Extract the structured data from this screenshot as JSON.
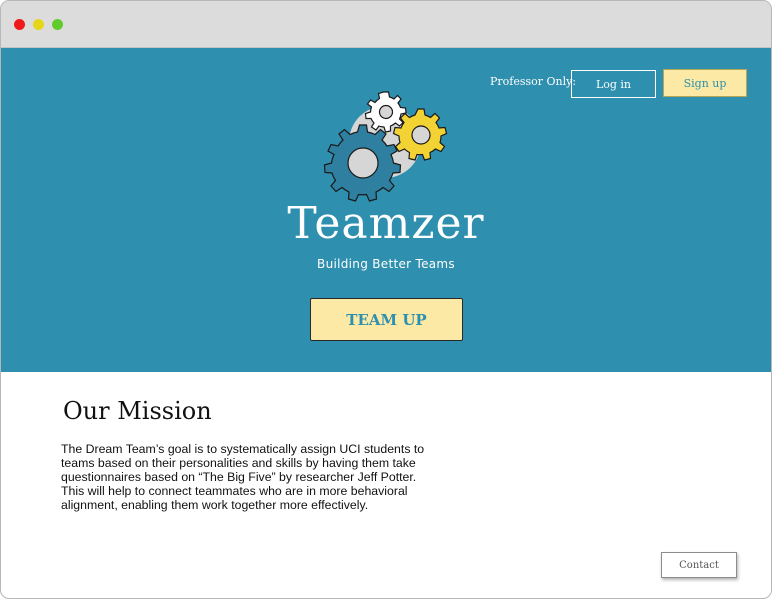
{
  "window": {
    "controls": [
      "close",
      "minimize",
      "maximize"
    ]
  },
  "header": {
    "professor_label": "Professor Only:",
    "login_label": "Log in",
    "signup_label": "Sign up"
  },
  "hero": {
    "logo_icon": "gears-icon",
    "brand_name": "Teamzer",
    "tagline": "Building Better Teams",
    "cta_label": "TEAM UP"
  },
  "mission": {
    "title": "Our Mission",
    "body": "The Dream Team’s goal is to systematically assign UCI students to teams based on their personalities and skills by having them take questionnaires based on “The Big Five” by researcher Jeff Potter. This will help to connect teammates who are in more behavioral alignment, enabling them work together more effectively."
  },
  "footer": {
    "contact_label": "Contact"
  },
  "colors": {
    "hero_bg": "#2e8fae",
    "button_yellow": "#fbe9a5",
    "gear_blue": "#2e7fa0",
    "gear_yellow": "#f3d234",
    "gear_white": "#ffffff",
    "gear_back": "#d6d6d6"
  }
}
